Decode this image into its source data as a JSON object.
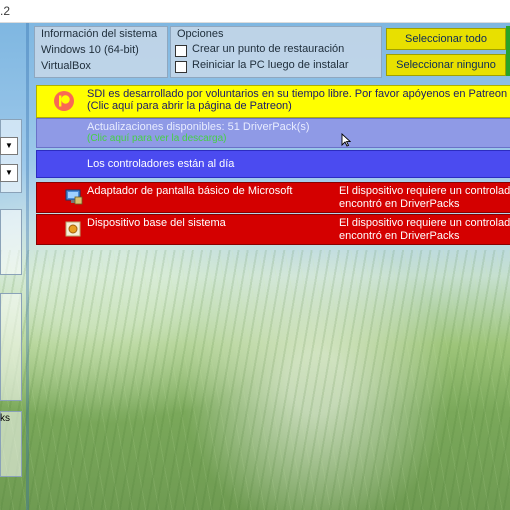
{
  "window": {
    "title_fragment": ".2"
  },
  "system_info": {
    "header": "Información del sistema",
    "os": "Windows 10 (64-bit)",
    "platform": "VirtualBox"
  },
  "options": {
    "header": "Opciones",
    "create_restore_point": "Crear un punto de restauración",
    "restart_after_install": "Reiniciar la PC luego de instalar"
  },
  "buttons": {
    "select_all": "Seleccionar todo",
    "select_none": "Seleccionar ninguno"
  },
  "banner": {
    "line1": "SDI es desarrollado por voluntarios en su tiempo libre. Por favor apóyenos en Patreon s",
    "line2": "(Clic aquí para abrir la página de Patreon)",
    "icon": "patreon-icon"
  },
  "updates": {
    "line1": "Actualizaciones disponibles: 51 DriverPack(s)",
    "line2": "(Clic aquí para ver la descarga)"
  },
  "up_to_date": {
    "text": "Los controladores están al día"
  },
  "devices": [
    {
      "name": "Adaptador de pantalla básico de Microsoft",
      "status_line1": "El dispositivo requiere un controlado",
      "status_line2": "encontró en DriverPacks",
      "icon": "monitor-icon"
    },
    {
      "name": "Dispositivo base del sistema",
      "status_line1": "El dispositivo requiere un controlado",
      "status_line2": "encontró en DriverPacks",
      "icon": "chip-icon"
    }
  ],
  "left_panel": {
    "fragment": "ks"
  },
  "colors": {
    "banner": "#ffff00",
    "updates": "#8f9ae6",
    "up_to_date": "#4b4bf0",
    "device_missing": "#d40000",
    "button": "#e8e000"
  }
}
